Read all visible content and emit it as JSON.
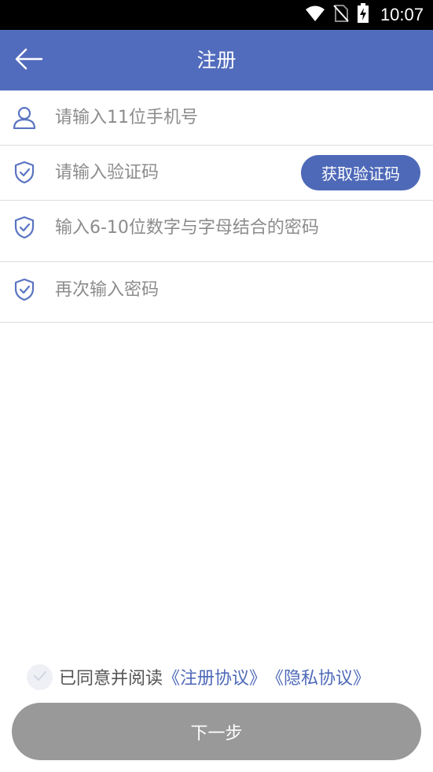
{
  "status_bar": {
    "time": "10:07",
    "icons": [
      "wifi-icon",
      "no-sim-icon",
      "battery-charging-icon"
    ]
  },
  "header": {
    "title": "注册",
    "back_icon": "arrow-left-icon"
  },
  "form": {
    "phone": {
      "placeholder": "请输入11位手机号",
      "value": "",
      "icon": "user-icon"
    },
    "code": {
      "placeholder": "请输入验证码",
      "value": "",
      "icon": "shield-check-icon",
      "button_label": "获取验证码"
    },
    "password": {
      "placeholder": "输入6-10位数字与字母结合的密码",
      "value": "",
      "icon": "shield-check-icon"
    },
    "confirm": {
      "placeholder": "再次输入密码",
      "value": "",
      "icon": "shield-check-icon"
    }
  },
  "agreement": {
    "prefix": "已同意并阅读",
    "register_link": "《注册协议》",
    "privacy_link": "《隐私协议》",
    "checked": false
  },
  "footer": {
    "next_label": "下一步"
  },
  "colors": {
    "primary": "#526cbd",
    "button": "#4e69b8",
    "disabled": "#999999",
    "icon": "#5a74c2",
    "divider": "#dcdcdc",
    "placeholder": "#8c8c8c"
  }
}
